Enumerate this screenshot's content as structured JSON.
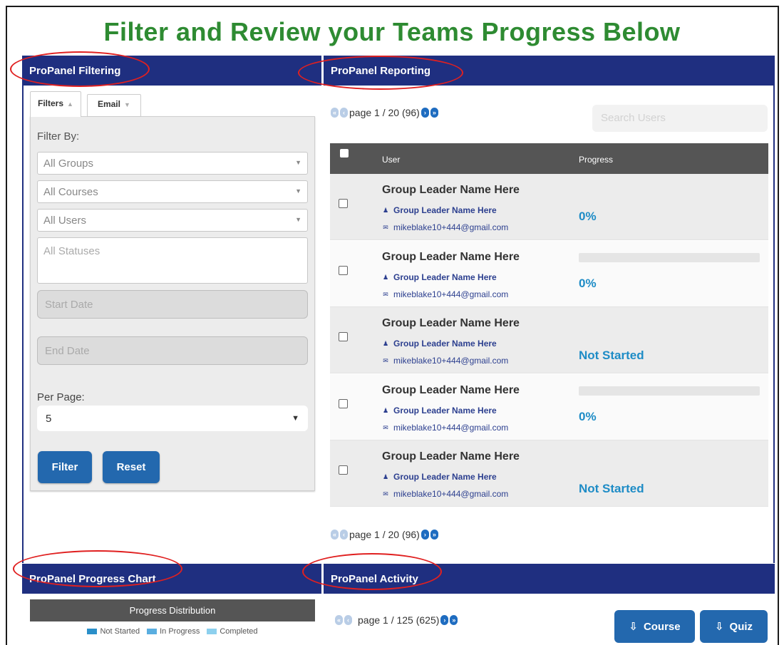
{
  "title": "Filter and Review your Teams Progress Below",
  "panels": {
    "filtering": "ProPanel Filtering",
    "reporting": "ProPanel Reporting",
    "chart": "ProPanel Progress Chart",
    "activity": "ProPanel Activity"
  },
  "filters": {
    "tab_filters": "Filters",
    "tab_email": "Email",
    "filter_by": "Filter By:",
    "groups": "All Groups",
    "courses": "All Courses",
    "users": "All Users",
    "statuses_placeholder": "All Statuses",
    "start_date": "Start Date",
    "end_date": "End Date",
    "per_page_label": "Per Page:",
    "per_page_value": "5",
    "filter_button": "Filter",
    "reset_button": "Reset"
  },
  "reporting": {
    "pager": "page 1 / 20 (96)",
    "search_placeholder": "Search Users",
    "col_user": "User",
    "col_progress": "Progress",
    "rows": [
      {
        "name": "Group Leader Name Here",
        "leader": "Group Leader Name Here",
        "email": "mikeblake10+444@gmail.com",
        "progress": "0%",
        "bar": false
      },
      {
        "name": "Group Leader Name Here",
        "leader": "Group Leader Name Here",
        "email": "mikeblake10+444@gmail.com",
        "progress": "0%",
        "bar": true
      },
      {
        "name": "Group Leader Name Here",
        "leader": "Group Leader Name Here",
        "email": "mikeblake10+444@gmail.com",
        "progress": "Not Started",
        "bar": false
      },
      {
        "name": "Group Leader Name Here",
        "leader": "Group Leader Name Here",
        "email": "mikeblake10+444@gmail.com",
        "progress": "0%",
        "bar": true
      },
      {
        "name": "Group Leader Name Here",
        "leader": "Group Leader Name Here",
        "email": "mikeblake10+444@gmail.com",
        "progress": "Not Started",
        "bar": false
      }
    ]
  },
  "chart": {
    "title": "Progress Distribution",
    "legend": [
      {
        "label": "Not Started",
        "color": "#2a8fc9"
      },
      {
        "label": "In Progress",
        "color": "#5aaee0"
      },
      {
        "label": "Completed",
        "color": "#8dd0ee"
      }
    ]
  },
  "activity": {
    "pager": "page 1 / 125 (625)",
    "course_button": "Course",
    "quiz_button": "Quiz"
  },
  "colors": {
    "header_bg": "#1f2f80",
    "title_green": "#2e8b32",
    "button_blue": "#2368ae",
    "progress_blue": "#1e8cc6",
    "annotation_red": "#e02020"
  }
}
